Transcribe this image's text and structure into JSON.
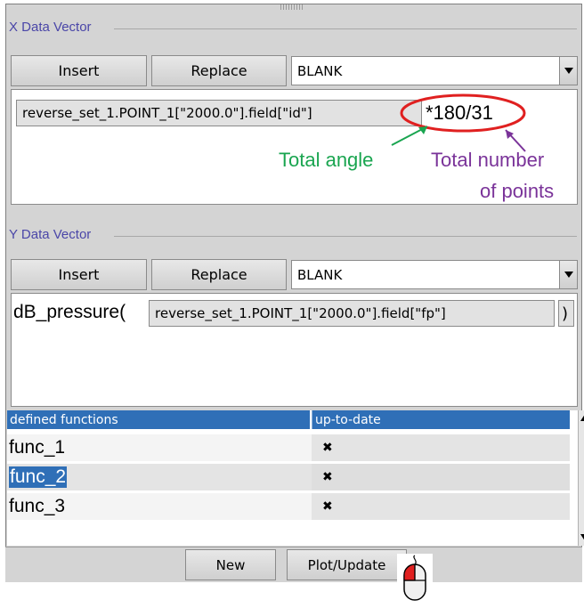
{
  "x_vector": {
    "section_label": "X Data Vector",
    "insert_label": "Insert",
    "replace_label": "Replace",
    "select_value": "BLANK",
    "expression_field": "reverse_set_1.POINT_1[\"2000.0\"].field[\"id\"]",
    "expression_suffix": "*180/31"
  },
  "annotations": {
    "total_angle": "Total angle",
    "total_points_line1": "Total number",
    "total_points_line2": "of points",
    "colors": {
      "angle": "#1aa550",
      "points": "#7a3399",
      "highlight_ellipse": "#e02020"
    }
  },
  "y_vector": {
    "section_label": "Y Data Vector",
    "insert_label": "Insert",
    "replace_label": "Replace",
    "select_value": "BLANK",
    "expression_prefix": "dB_pressure(",
    "expression_field": "reverse_set_1.POINT_1[\"2000.0\"].field[\"fp\"]",
    "expression_suffix": ")"
  },
  "functions_table": {
    "headers": [
      "defined functions",
      "up-to-date"
    ],
    "rows": [
      {
        "name": "func_1",
        "up_to_date": "✖",
        "selected": false
      },
      {
        "name": "func_2",
        "up_to_date": "✖",
        "selected": true
      },
      {
        "name": "func_3",
        "up_to_date": "✖",
        "selected": false
      }
    ],
    "header_color": "#2f6fb7"
  },
  "bottom_bar": {
    "new_label": "New",
    "plot_update_label": "Plot/Update"
  },
  "icons": {
    "dropdown": "chevron-down-icon",
    "mouse": "mouse-left-click-icon",
    "scroll_up": "scroll-up-icon",
    "scroll_down": "scroll-down-icon"
  }
}
